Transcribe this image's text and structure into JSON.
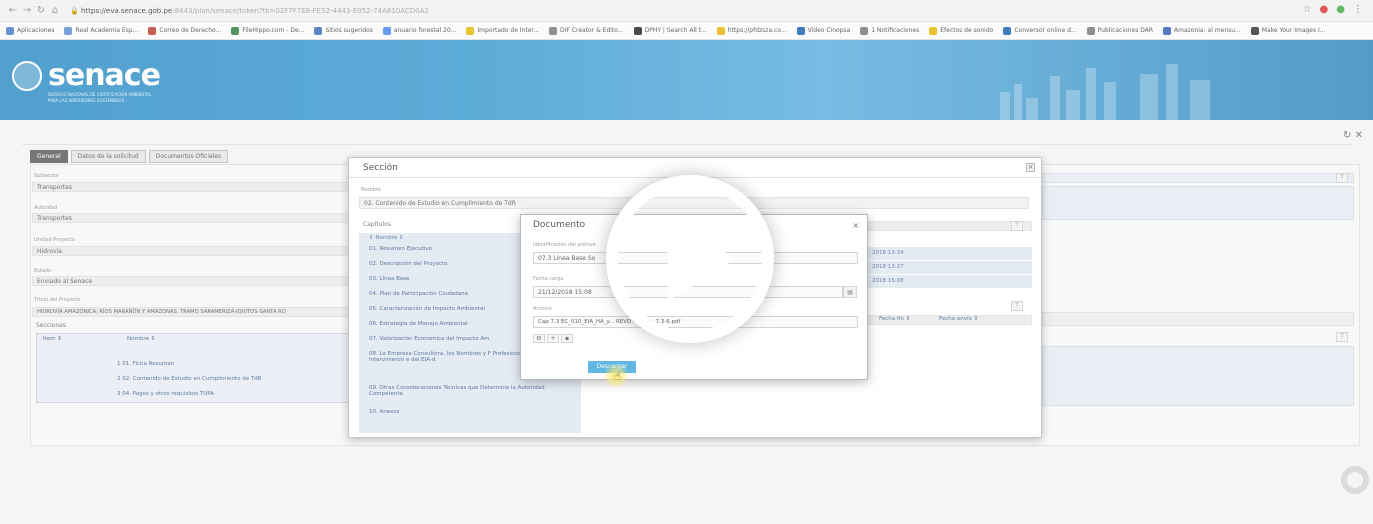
{
  "browser": {
    "url_domain": "https://eva.senace.gob.pe",
    "url_path": ":8443/plan/senace/token?tk=02F7F7E8-FE52-4443-E052-74A810ACD0A2",
    "bookmarks": [
      {
        "label": "Aplicaciones",
        "color": "#4a7ac8"
      },
      {
        "label": "Real Academia Esp...",
        "color": "#5a8ad0"
      },
      {
        "label": "Correo de Derecho...",
        "color": "#c0392b"
      },
      {
        "label": "FileHippo.com - De...",
        "color": "#2f7d3a"
      },
      {
        "label": "Sitios sugeridos",
        "color": "#3a6ab8"
      },
      {
        "label": "anuario forestal 20...",
        "color": "#4285f4"
      },
      {
        "label": "Importado de Inter...",
        "color": "#e6b800"
      },
      {
        "label": "DIF Creator & Edito...",
        "color": "#777777"
      },
      {
        "label": "DPHY | Search All t...",
        "color": "#222222"
      },
      {
        "label": "https://pfdzsza.co...",
        "color": "#e6b800"
      },
      {
        "label": "Video Cinopsa",
        "color": "#1a5fb4"
      },
      {
        "label": "1 Notificaciones",
        "color": "#777777"
      },
      {
        "label": "Efectos de sonido",
        "color": "#e6b800"
      },
      {
        "label": "Conversor online d...",
        "color": "#1a5fb4"
      },
      {
        "label": "Publicaciones DAR",
        "color": "#777777"
      },
      {
        "label": "Amazonia: al mensu...",
        "color": "#2f5db4"
      },
      {
        "label": "Make Your Images I...",
        "color": "#333333"
      }
    ]
  },
  "header": {
    "logo_text": "senace",
    "logo_sub_1": "SERVICIO NACIONAL DE CERTIFICACIÓN AMBIENTAL",
    "logo_sub_2": "PARA LAS INVERSIONES SOSTENIBLES"
  },
  "form": {
    "tabs": [
      "General",
      "Datos de la solicitud",
      "Documentos Oficiales"
    ],
    "fields": [
      {
        "label": "Subsector",
        "value": "Transportes"
      },
      {
        "label": "Actividad",
        "value": "Transportes"
      },
      {
        "label": "Unidad Proyecto",
        "value": "Hidrovía"
      },
      {
        "label": "Estado",
        "value": "Enviado al Senace"
      },
      {
        "label": "Título del Proyecto",
        "value": "HIDROVÍA AMAZÓNICA: RÍOS MARAÑÓN Y AMAZONAS, TRAMO SARAMERIZA-IQUITOS-SANTA RO"
      }
    ],
    "secciones_title": "Secciones",
    "secciones_cols": [
      "Item ⇕",
      "Nombre ⇕"
    ],
    "secciones_rows": [
      "1  01. Ficha Resumen",
      "2  02. Contenido de Estudio en Cumplimiento de TdR",
      "3  04. Pagos y otros requisitos TUPA"
    ]
  },
  "seccion_dialog": {
    "title": "Sección",
    "nombre_label": "Nombre",
    "nombre_value": "02. Contenido de Estudio en Cumplimiento de TdR",
    "capitulos_label": "Capítulos",
    "capitulos_col": "⇕  Nombre ⇕",
    "capitulos": [
      "01. Resumen Ejecutivo",
      "02. Descripción del Proyecto",
      "03. Línea Base",
      "04. Plan de Participación Ciudadana",
      "05. Caracterización de Impacto Ambiental",
      "06. Estrategia de Manejo Ambiental",
      "07. Valorización Económica del Impacto Am",
      "08. La Empresa Consultora, los Nombres y F Profesionales y Técnicos que Intervinieron e del EIA-d",
      "09. Otras Consideraciones Técnicas que Determine la Autoridad Competente",
      "10. Anexos"
    ],
    "doc_rows": [
      "2018 13:24",
      "2018 13:27",
      "2018 15:08"
    ],
    "table2_cols": [
      "Fecha fin ⇕",
      "Fecha envío ⇕"
    ]
  },
  "documento_dialog": {
    "title": "Documento",
    "ident_label": "Identificación del archivo",
    "ident_value": "07.3 Línea Base So",
    "fecha_label": "Fecha carga",
    "fecha_value": "21/12/2018 15:08",
    "archivo_label": "Archivo",
    "archivo_value": "Cap 7.3 EC_010_EIA_HA_y...         REVD - Anexo 7.3-6.pdf",
    "download_label": "Descargar"
  }
}
